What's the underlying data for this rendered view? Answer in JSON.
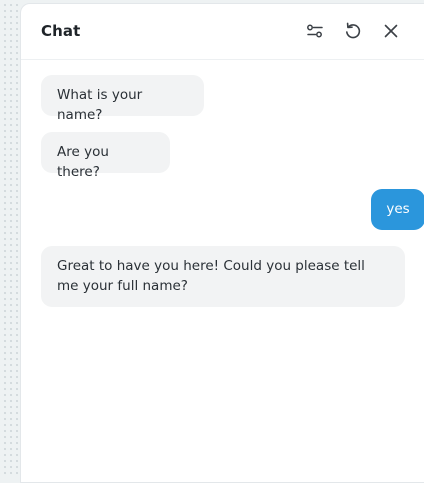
{
  "header": {
    "title": "Chat",
    "icons": {
      "settings": "sliders-icon",
      "reset": "refresh-icon",
      "close": "close-icon"
    }
  },
  "messages": [
    {
      "role": "bot",
      "text": "What is your name?"
    },
    {
      "role": "bot",
      "text": "Are you there?"
    },
    {
      "role": "user",
      "text": "yes"
    },
    {
      "role": "bot",
      "text": "Great to have you here! Could you please tell me your full name?"
    }
  ],
  "colors": {
    "user_bubble": "#2b96dc",
    "bot_bubble": "#f2f3f4",
    "text": "#2a3036"
  }
}
